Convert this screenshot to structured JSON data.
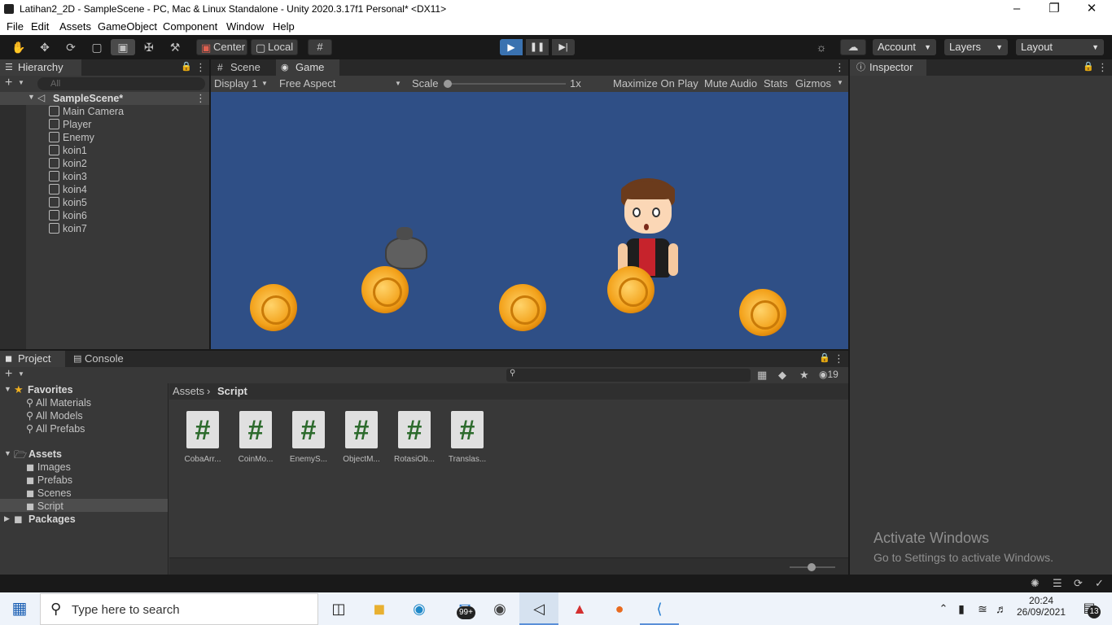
{
  "window": {
    "title": "Latihan2_2D - SampleScene - PC, Mac & Linux Standalone - Unity 2020.3.17f1 Personal* <DX11>",
    "controls": [
      "minimize-icon",
      "restore-icon",
      "close-icon"
    ]
  },
  "menu": [
    "File",
    "Edit",
    "Assets",
    "GameObject",
    "Component",
    "Window",
    "Help"
  ],
  "toolbar": {
    "pivot": "Center",
    "space": "Local",
    "account": "Account",
    "layers": "Layers",
    "layout": "Layout",
    "play_color": "#3a72b0"
  },
  "hierarchy": {
    "tab": "Hierarchy",
    "search_placeholder": "All",
    "scene": "SampleScene*",
    "items": [
      "Main Camera",
      "Player",
      "Enemy",
      "koin1",
      "koin2",
      "koin3",
      "koin4",
      "koin5",
      "koin6",
      "koin7"
    ]
  },
  "game": {
    "tabs": [
      "Scene",
      "Game"
    ],
    "display": "Display 1",
    "aspect": "Free Aspect",
    "scale_label": "Scale",
    "scale_value": "1x",
    "scale_fraction": 0.0,
    "toggles": [
      "Maximize On Play",
      "Mute Audio",
      "Stats",
      "Gizmos"
    ],
    "background": "#2f4f86"
  },
  "inspector": {
    "tab": "Inspector"
  },
  "project": {
    "tabs": [
      "Project",
      "Console"
    ],
    "hidden_count": "19",
    "favorites_label": "Favorites",
    "favorites": [
      "All Materials",
      "All Models",
      "All Prefabs"
    ],
    "assets_label": "Assets",
    "folders": [
      "Images",
      "Prefabs",
      "Scenes",
      "Script"
    ],
    "packages_label": "Packages",
    "breadcrumb": [
      "Assets",
      "Script"
    ],
    "files": [
      "CobaArr...",
      "CoinMo...",
      "EnemyS...",
      "ObjectM...",
      "RotasiOb...",
      "Translas..."
    ]
  },
  "watermark": {
    "line1": "Activate Windows",
    "line2": "Go to Settings to activate Windows."
  },
  "taskbar": {
    "search_placeholder": "Type here to search",
    "mail_badge": "99+",
    "time": "20:24",
    "date": "26/09/2021",
    "notif_count": "13"
  }
}
